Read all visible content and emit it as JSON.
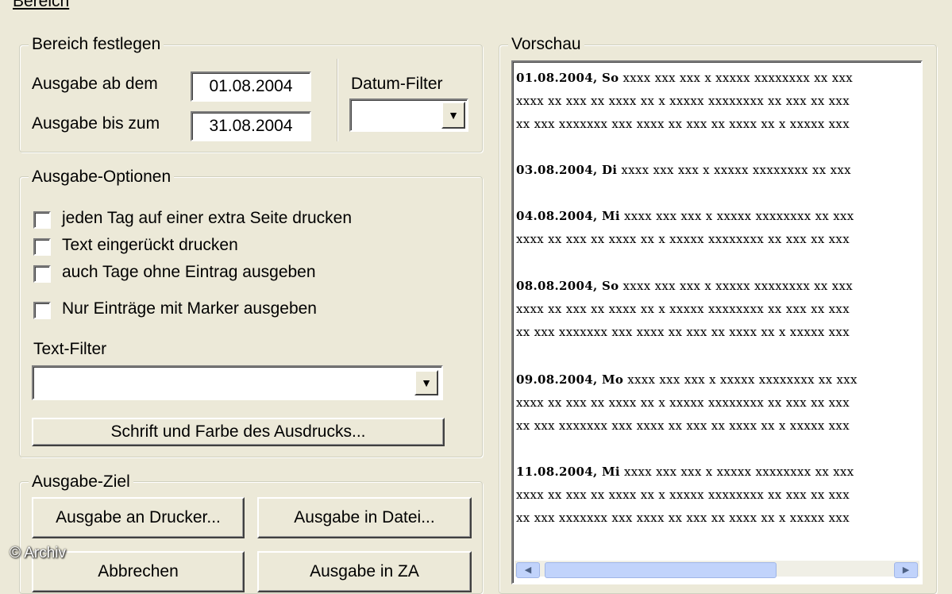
{
  "window": {
    "title_partial": "Bereich"
  },
  "bereich": {
    "legend": "Bereich festlegen",
    "ab_label": "Ausgabe ab dem",
    "ab_value": "01.08.2004",
    "bis_label": "Ausgabe bis zum",
    "bis_value": "31.08.2004",
    "datum_filter_label": "Datum-Filter",
    "datum_filter_value": ""
  },
  "optionen": {
    "legend": "Ausgabe-Optionen",
    "checkboxes": [
      {
        "label": "jeden Tag auf einer extra Seite drucken",
        "checked": false
      },
      {
        "label": "Text eingerückt drucken",
        "checked": false
      },
      {
        "label": "auch Tage ohne Eintrag ausgeben",
        "checked": false
      },
      {
        "label": "Nur Einträge mit Marker ausgeben",
        "checked": false
      }
    ],
    "text_filter_label": "Text-Filter",
    "text_filter_value": "",
    "font_button": "Schrift und Farbe des Ausdrucks..."
  },
  "ziel": {
    "legend": "Ausgabe-Ziel",
    "drucker_button": "Ausgabe an Drucker...",
    "datei_button": "Ausgabe in Datei...",
    "abbrechen_button": "Abbrechen",
    "za_button": "Ausgabe in ZA"
  },
  "vorschau": {
    "legend": "Vorschau",
    "entries": [
      {
        "head": "01.08.2004, So",
        "lines": [
          "xxxx xxx xxx x xxxxx xxxxxxxx xx xxx",
          "xxxx xx xxx xx xxxx xx x xxxxx xxxxxxxx xx xxx xx xxx",
          "xx xxx xxxxxxx xxx xxxx xx xxx xx xxxx xx x xxxxx xxx"
        ]
      },
      {
        "head": "03.08.2004, Di",
        "lines": [
          "xxxx xxx xxx x xxxxx xxxxxxxx xx xxx"
        ]
      },
      {
        "head": "04.08.2004, Mi",
        "lines": [
          "xxxx xxx xxx x xxxxx xxxxxxxx xx xxx",
          "xxxx xx xxx xx xxxx xx x xxxxx xxxxxxxx xx xxx xx xxx"
        ]
      },
      {
        "head": "08.08.2004, So",
        "lines": [
          "xxxx xxx xxx x xxxxx xxxxxxxx xx xxx",
          "xxxx xx xxx xx xxxx xx x xxxxx xxxxxxxx xx xxx xx xxx",
          "xx xxx xxxxxxx xxx xxxx xx xxx xx xxxx xx x xxxxx xxx"
        ]
      },
      {
        "head": "09.08.2004, Mo",
        "lines": [
          "xxxx xxx xxx x xxxxx xxxxxxxx xx xxx",
          "xxxx xx xxx xx xxxx xx x xxxxx xxxxxxxx xx xxx xx xxx",
          "xx xxx xxxxxxx xxx xxxx xx xxx xx xxxx xx x xxxxx xxx"
        ]
      },
      {
        "head": "11.08.2004, Mi",
        "lines": [
          "xxxx xxx xxx x xxxxx xxxxxxxx xx xxx",
          "xxxx xx xxx xx xxxx xx x xxxxx xxxxxxxx xx xxx xx xxx",
          "xx xxx xxxxxxx xxx xxxx xx xxx xx xxxx xx x xxxxx xxx"
        ]
      }
    ]
  },
  "watermark": "© Archiv",
  "icons": {
    "dropdown": "chevron-down-icon",
    "scroll_left": "arrow-left-icon",
    "scroll_right": "arrow-right-icon"
  }
}
